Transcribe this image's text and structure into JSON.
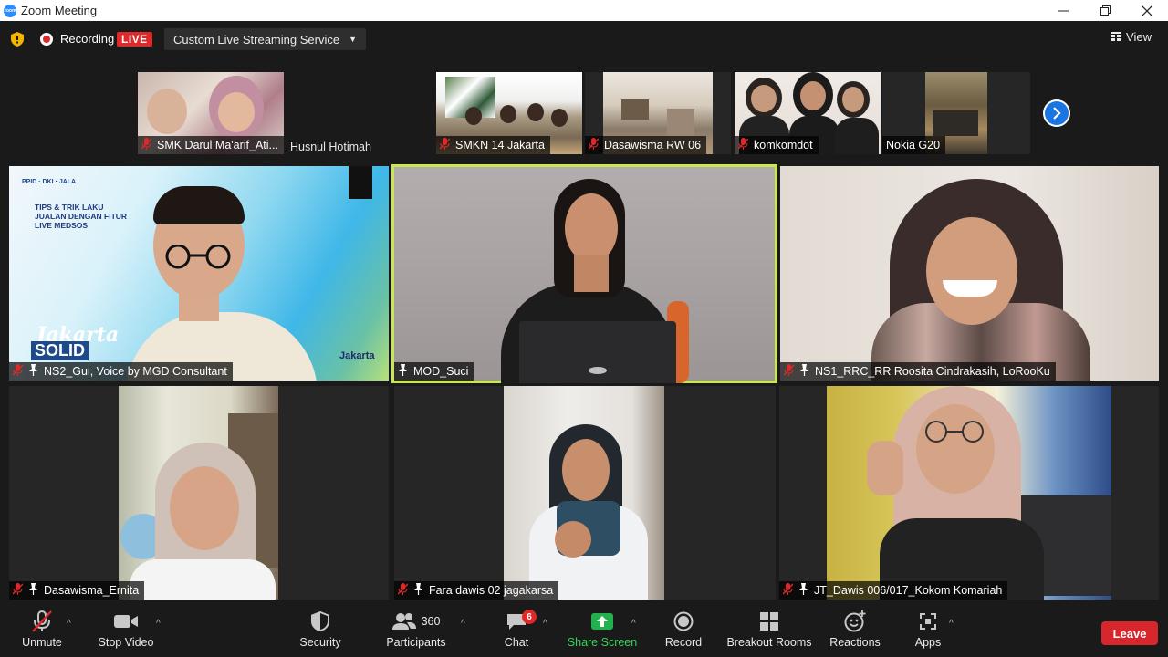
{
  "window": {
    "title": "Zoom Meeting",
    "logo_text": "zoom"
  },
  "topbar": {
    "recording_label": "Recording",
    "live_label": "LIVE",
    "stream_service": "Custom Live Streaming Service",
    "view_label": "View"
  },
  "strip": [
    {
      "name": "SMK Darul Ma'arif_Ati...",
      "muted": true
    },
    {
      "name": "Husnul Hotimah",
      "muted": false
    },
    {
      "name": "SMKN 14 Jakarta",
      "muted": true
    },
    {
      "name": "Dasawisma RW 06",
      "muted": true
    },
    {
      "name": "komkomdot",
      "muted": true
    },
    {
      "name": "Nokia G20",
      "muted": false
    }
  ],
  "grid": [
    {
      "name": "NS2_Gui, Voice by MGD Consultant",
      "muted": true,
      "pinned": true
    },
    {
      "name": "MOD_Suci",
      "muted": false,
      "pinned": true,
      "active": true
    },
    {
      "name": "NS1_RRC_RR Roosita Cindrakasih, LoRooKu",
      "muted": true,
      "pinned": true
    },
    {
      "name": "Dasawisma_Ernita",
      "muted": true,
      "pinned": true
    },
    {
      "name": "Fara dawis 02 jagakarsa",
      "muted": true,
      "pinned": true
    },
    {
      "name": "JT_Dawis 006/017_Kokom Komariah",
      "muted": true,
      "pinned": true
    }
  ],
  "slide": {
    "line1": "TIPS & TRIK LAKU",
    "line2": "JUALAN DENGAN FITUR",
    "line3": "LIVE MEDSOS",
    "brand1": "Jakarta",
    "brand2": "SOLID",
    "brand3": "Jakarta"
  },
  "toolbar": {
    "unmute": "Unmute",
    "stop_video": "Stop Video",
    "security": "Security",
    "participants": "Participants",
    "participants_count": "360",
    "chat": "Chat",
    "chat_badge": "6",
    "share_screen": "Share Screen",
    "record": "Record",
    "breakout_rooms": "Breakout Rooms",
    "reactions": "Reactions",
    "apps": "Apps",
    "leave": "Leave"
  },
  "colors": {
    "active_speaker": "#c9e656",
    "live": "#e02828",
    "share": "#23b14d",
    "leave": "#d7262c"
  }
}
